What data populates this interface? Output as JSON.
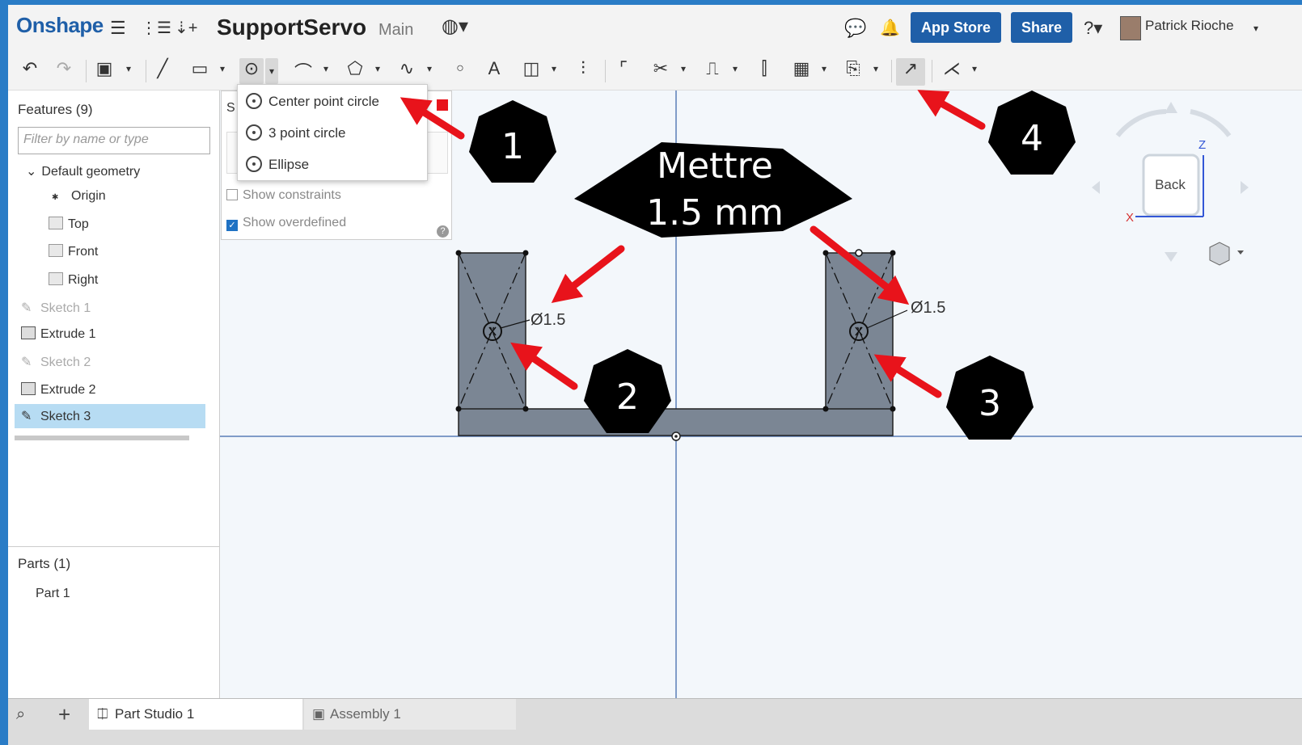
{
  "header": {
    "logo": "Onshape",
    "document_title": "SupportServo",
    "branch": "Main",
    "app_store": "App Store",
    "share": "Share",
    "user_name": "Patrick Rioche",
    "help_icon": "help-icon",
    "accent_color": "#1f5fa8"
  },
  "toolbar": {
    "tools": [
      "undo-icon",
      "redo-icon",
      "sketch-icon",
      "line-icon",
      "rectangle-icon",
      "circle-icon",
      "arc-icon",
      "polygon-icon",
      "spline-icon",
      "point-icon",
      "text-icon",
      "offset-icon",
      "mirror-icon",
      "fillet-icon",
      "trim-icon",
      "extend-icon",
      "project-icon",
      "pattern-icon",
      "export-icon",
      "construction-icon",
      "dimension-icon"
    ]
  },
  "circle_dropdown": {
    "items": [
      "Center point circle",
      "3 point circle",
      "Ellipse"
    ]
  },
  "sketch_panel": {
    "show_constraints": "Show constraints",
    "show_overdefined": "Show overdefined",
    "show_constraints_checked": false,
    "show_overdefined_checked": true
  },
  "sidebar": {
    "features_title": "Features (9)",
    "filter_placeholder": "Filter by name or type",
    "default_geometry": "Default geometry",
    "items": [
      {
        "label": "Origin",
        "type": "origin"
      },
      {
        "label": "Top",
        "type": "plane"
      },
      {
        "label": "Front",
        "type": "plane"
      },
      {
        "label": "Right",
        "type": "plane"
      },
      {
        "label": "Sketch 1",
        "type": "sketch"
      },
      {
        "label": "Extrude 1",
        "type": "extrude"
      },
      {
        "label": "Sketch 2",
        "type": "sketch"
      },
      {
        "label": "Extrude 2",
        "type": "extrude"
      },
      {
        "label": "Sketch 3",
        "type": "sketch"
      }
    ],
    "parts_title": "Parts (1)",
    "parts": [
      "Part 1"
    ]
  },
  "canvas": {
    "dimension_left": "Ø1.5",
    "dimension_right": "Ø1.5",
    "view_cube_label": "Back",
    "axis_z": "Z",
    "axis_x": "X"
  },
  "annotations": {
    "callout_main_line1": "Mettre",
    "callout_main_line2": "1.5 mm",
    "badges": [
      "1",
      "2",
      "3",
      "4"
    ],
    "arrow_color": "#e8131b"
  },
  "tabs": [
    {
      "label": "Part Studio 1",
      "active": true
    },
    {
      "label": "Assembly 1",
      "active": false
    }
  ]
}
